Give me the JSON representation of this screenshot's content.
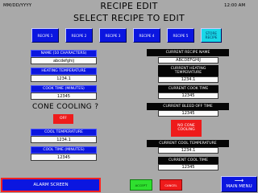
{
  "header": {
    "date": "MM/DD/YYYY",
    "title": "RECIPE EDIT",
    "time": "12:00 AM",
    "subtitle": "SELECT RECIPE TO EDIT"
  },
  "recipe_tabs": [
    {
      "label": "RECIPE 1"
    },
    {
      "label": "RECIPE 2"
    },
    {
      "label": "RECIPE 3"
    },
    {
      "label": "RECIPE 4"
    },
    {
      "label": "RECIPE 5"
    },
    {
      "label": "STORE RECIPE",
      "active": true
    }
  ],
  "left": {
    "name_label": "NAME (10 CHARACTERS)",
    "name_value": "abcdefghij",
    "heating_temp_label": "HEATING TEMPERATURE",
    "heating_temp_value": "1234.1",
    "cook_time_label": "COOK TIME (MINUTES)",
    "cook_time_value": "12345",
    "cone_cooling_label": "CONE COOLING ?",
    "cone_cooling_toggle": "OFF",
    "cool_temp_label": "COOL TEMPERATURE",
    "cool_temp_value": "1234.1",
    "cool_time_label": "COOL TIME (MINUTES)",
    "cool_time_value": "12345"
  },
  "right": {
    "current_name_label": "CURRENT RECIPE NAME",
    "current_name_value": "ABCDEFGHIJ",
    "current_heating_label": "CURRENT HEATING TEMPERATURE",
    "current_heating_value": "1234.1",
    "current_cook_label": "CURRENT COOK TIME",
    "current_cook_value": "12345",
    "current_bleed_label": "CURRENT BLEED OFF TIME",
    "current_bleed_value": "12345",
    "no_cone_cooling_label": "NO CONE COOLING",
    "current_cool_temp_label": "CURRENT COOL TEMPERATURE",
    "current_cool_temp_value": "1234.1",
    "current_cool_time_label": "CURRENT COOL TIME",
    "current_cool_time_value": "12345"
  },
  "footer": {
    "alarm_label": "ALARM SCREEN",
    "accept_label": "ACCEPT",
    "cancel_label": "CANCEL",
    "main_menu_label": "MAIN MENU",
    "main_menu_arrow": "⟶"
  },
  "colors": {
    "background": "#a9a9a9",
    "button_blue": "#0b16e0",
    "active_cyan": "#18d8e8",
    "alert_red": "#ee1b1b",
    "accept_green": "#2fe02f"
  }
}
